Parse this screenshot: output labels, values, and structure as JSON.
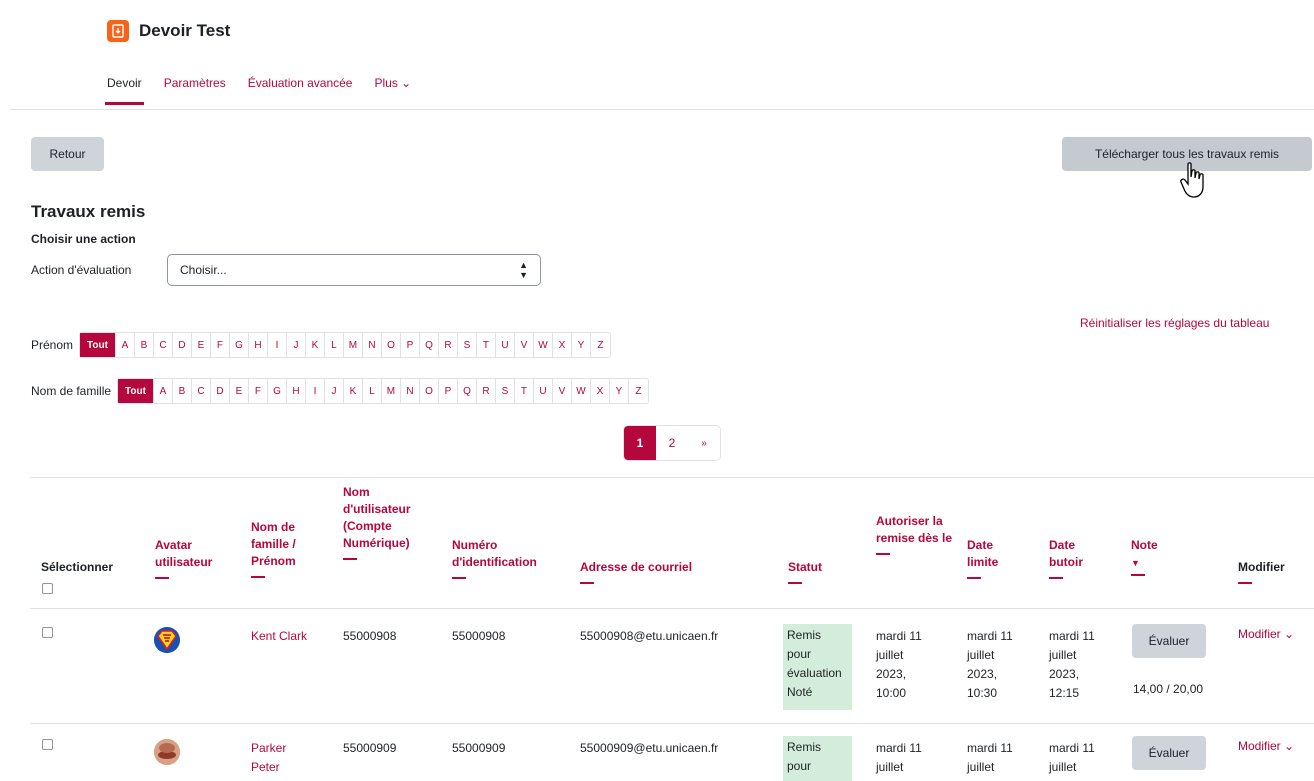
{
  "header": {
    "title": "Devoir Test",
    "tabs": [
      {
        "label": "Devoir",
        "active": true
      },
      {
        "label": "Paramètres"
      },
      {
        "label": "Évaluation avancée"
      },
      {
        "label": "Plus ⌄"
      }
    ]
  },
  "buttons": {
    "back": "Retour",
    "download": "Télécharger tous les travaux remis"
  },
  "section": {
    "title": "Travaux remis",
    "choose_action": "Choisir une action",
    "grading_action_label": "Action d'évaluation",
    "grading_action_value": "Choisir..."
  },
  "reset_link": "Réinitialiser les réglages du tableau",
  "filters": {
    "firstname_label": "Prénom",
    "lastname_label": "Nom de famille",
    "all_label": "Tout",
    "letters": [
      "A",
      "B",
      "C",
      "D",
      "E",
      "F",
      "G",
      "H",
      "I",
      "J",
      "K",
      "L",
      "M",
      "N",
      "O",
      "P",
      "Q",
      "R",
      "S",
      "T",
      "U",
      "V",
      "W",
      "X",
      "Y",
      "Z"
    ]
  },
  "pagination": {
    "pages": [
      "1",
      "2"
    ],
    "next": "»",
    "current": "1"
  },
  "table": {
    "headers": {
      "select": "Sélectionner",
      "avatar": "Avatar utilisateur",
      "name": "Nom de famille / Prénom",
      "username": "Nom d'utilisateur (Compte Numérique)",
      "idnumber": "Numéro d'identification",
      "email": "Adresse de courriel",
      "status": "Statut",
      "allow_from": "Autoriser la remise dès le",
      "due": "Date limite",
      "cutoff": "Date butoir",
      "grade": "Note",
      "edit": "Modifier"
    },
    "rows": [
      {
        "name": "Kent Clark",
        "username": "55000908",
        "idnumber": "55000908",
        "email": "55000908@etu.unicaen.fr",
        "status": "Remis pour évaluation Noté",
        "allow_from": "mardi 11 juillet 2023, 10:00",
        "due": "mardi 11 juillet 2023, 10:30",
        "cutoff": "mardi 11 juillet 2023, 12:15",
        "grade_button": "Évaluer",
        "grade": "14,00 / 20,00",
        "edit": "Modifier ⌄"
      },
      {
        "name": "Parker Peter",
        "username": "55000909",
        "idnumber": "55000909",
        "email": "55000909@etu.unicaen.fr",
        "status": "Remis pour",
        "allow_from": "mardi 11 juillet",
        "due": "mardi 11 juillet",
        "cutoff": "mardi 11 juillet",
        "grade_button": "Évaluer",
        "edit": "Modifier ⌄"
      }
    ]
  },
  "colors": {
    "accent": "#b5073d",
    "status_bg": "#d4edda",
    "icon_orange": "#f7631b"
  }
}
